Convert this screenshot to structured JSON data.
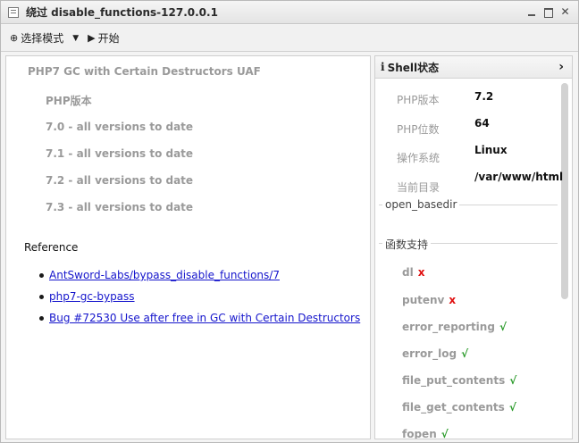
{
  "window": {
    "title": "绕过 disable_functions-127.0.0.1",
    "controls": [
      "−",
      "□",
      "✕"
    ]
  },
  "toolbar": {
    "mode_label": "选择模式",
    "start_label": "开始"
  },
  "left": {
    "exploit_title": "PHP7 GC with Certain Destructors UAF",
    "php_version_label": "PHP版本",
    "versions": [
      "7.0 - all versions to date",
      "7.1 - all versions to date",
      "7.2 - all versions to date",
      "7.3 - all versions to date"
    ],
    "reference_heading": "Reference",
    "references": [
      "AntSword-Labs/bypass_disable_functions/7",
      "php7-gc-bypass",
      "Bug #72530 Use after free in GC with Certain Destructors"
    ]
  },
  "right": {
    "header": "Shell状态",
    "info": [
      {
        "label": "PHP版本",
        "value": "7.2"
      },
      {
        "label": "PHP位数",
        "value": "64"
      },
      {
        "label": "操作系统",
        "value": "Linux"
      },
      {
        "label": "当前目录",
        "value": "/var/www/html"
      }
    ],
    "open_basedir_legend": "open_basedir",
    "functions_legend": "函数支持",
    "functions": [
      {
        "name": "dl",
        "supported": false,
        "mark": "x"
      },
      {
        "name": "putenv",
        "supported": false,
        "mark": "x"
      },
      {
        "name": "error_reporting",
        "supported": true,
        "mark": "√"
      },
      {
        "name": "error_log",
        "supported": true,
        "mark": "√"
      },
      {
        "name": "file_put_contents",
        "supported": true,
        "mark": "√"
      },
      {
        "name": "file_get_contents",
        "supported": true,
        "mark": "√"
      },
      {
        "name": "fopen",
        "supported": true,
        "mark": "√"
      }
    ]
  },
  "colors": {
    "link": "#1515cc",
    "supported": "#2a9a2a",
    "unsupported": "#e01010",
    "muted_text": "#9a9a9a"
  }
}
